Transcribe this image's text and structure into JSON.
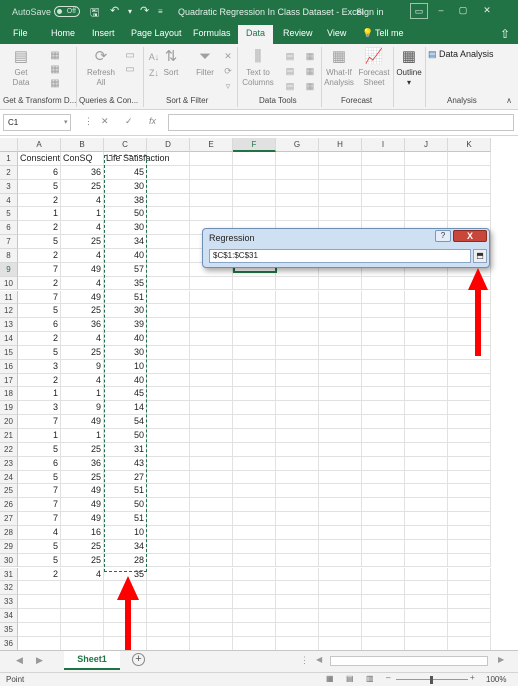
{
  "titlebar": {
    "autosave_label": "AutoSave",
    "autosave_state": "Off",
    "title": "Quadratic Regression In Class Dataset  -  Excel",
    "signin": "Sign in"
  },
  "tabs": [
    "File",
    "Home",
    "Insert",
    "Page Layout",
    "Formulas",
    "Data",
    "Review",
    "View",
    "Tell me"
  ],
  "active_tab": "Data",
  "ribbon": {
    "get_data": "Get Data",
    "refresh_all": "Refresh All",
    "sort": "Sort",
    "filter": "Filter",
    "text_to_columns": "Text to Columns",
    "what_if": "What-If Analysis",
    "forecast_sheet": "Forecast Sheet",
    "outline": "Outline",
    "data_analysis": "Data Analysis",
    "groups": [
      "Get & Transform D...",
      "Queries & Con...",
      "Sort & Filter",
      "Data Tools",
      "Forecast",
      "Analysis"
    ]
  },
  "formula_bar": {
    "name_box": "C1",
    "fx": "fx",
    "value": ""
  },
  "columns": [
    "A",
    "B",
    "C",
    "D",
    "E",
    "F",
    "G",
    "H",
    "I",
    "J",
    "K"
  ],
  "selected_column": "F",
  "selected_row": 9,
  "headers": [
    "Conscient",
    "ConSQ",
    "Life Satisfaction"
  ],
  "rows": [
    [
      6,
      36,
      45
    ],
    [
      5,
      25,
      30
    ],
    [
      2,
      4,
      38
    ],
    [
      1,
      1,
      50
    ],
    [
      2,
      4,
      30
    ],
    [
      5,
      25,
      34
    ],
    [
      2,
      4,
      40
    ],
    [
      7,
      49,
      57
    ],
    [
      2,
      4,
      35
    ],
    [
      7,
      49,
      51
    ],
    [
      5,
      25,
      30
    ],
    [
      6,
      36,
      39
    ],
    [
      2,
      4,
      40
    ],
    [
      5,
      25,
      30
    ],
    [
      3,
      9,
      10
    ],
    [
      2,
      4,
      40
    ],
    [
      1,
      1,
      45
    ],
    [
      3,
      9,
      14
    ],
    [
      7,
      49,
      54
    ],
    [
      1,
      1,
      50
    ],
    [
      5,
      25,
      31
    ],
    [
      6,
      36,
      43
    ],
    [
      5,
      25,
      27
    ],
    [
      7,
      49,
      51
    ],
    [
      7,
      49,
      50
    ],
    [
      7,
      49,
      51
    ],
    [
      4,
      16,
      10
    ],
    [
      5,
      25,
      34
    ],
    [
      5,
      25,
      28
    ],
    [
      2,
      4,
      35
    ]
  ],
  "total_rows": 36,
  "dialog": {
    "title": "Regression",
    "help": "?",
    "close": "X",
    "range_value": "$C$1:$C$31"
  },
  "sheet_tab": "Sheet1",
  "status": "Point",
  "zoom": "100%",
  "colors": {
    "excel_green": "#217346",
    "arrow_red": "#ff0000"
  }
}
